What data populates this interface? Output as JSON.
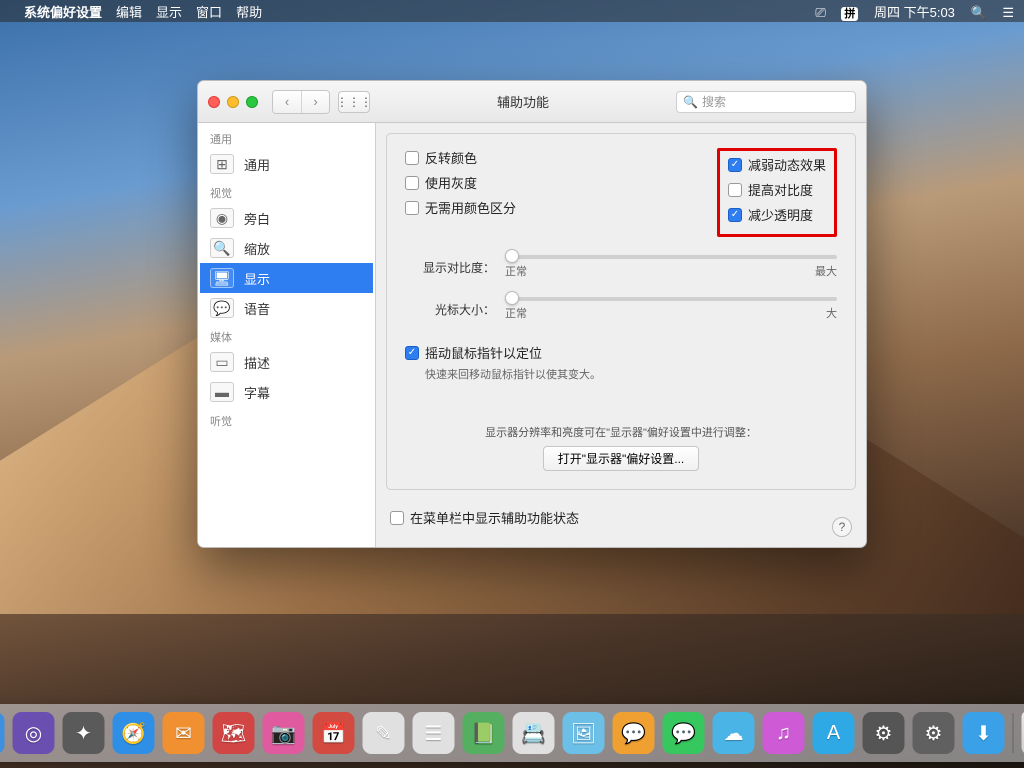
{
  "menubar": {
    "app": "系统偏好设置",
    "items": [
      "编辑",
      "显示",
      "窗口",
      "帮助"
    ],
    "pinyin": "拼",
    "datetime": "周四 下午5:03"
  },
  "window": {
    "title": "辅助功能",
    "search_placeholder": "搜索"
  },
  "sidebar": {
    "sections": [
      {
        "label": "通用",
        "items": [
          {
            "label": "通用",
            "icon": "⊞"
          }
        ]
      },
      {
        "label": "视觉",
        "items": [
          {
            "label": "旁白",
            "icon": "◉"
          },
          {
            "label": "缩放",
            "icon": "🔍"
          },
          {
            "label": "显示",
            "icon": "🖥",
            "selected": true
          },
          {
            "label": "语音",
            "icon": "💬"
          }
        ]
      },
      {
        "label": "媒体",
        "items": [
          {
            "label": "描述",
            "icon": "▭"
          },
          {
            "label": "字幕",
            "icon": "▬"
          }
        ]
      },
      {
        "label": "听觉",
        "items": []
      }
    ]
  },
  "options": {
    "left": [
      {
        "label": "反转颜色",
        "checked": false
      },
      {
        "label": "使用灰度",
        "checked": false
      },
      {
        "label": "无需用颜色区分",
        "checked": false
      }
    ],
    "right": [
      {
        "label": "减弱动态效果",
        "checked": true
      },
      {
        "label": "提高对比度",
        "checked": false
      },
      {
        "label": "减少透明度",
        "checked": true
      }
    ],
    "contrast": {
      "label": "显示对比度：",
      "min": "正常",
      "max": "最大"
    },
    "cursor": {
      "label": "光标大小：",
      "min": "正常",
      "max": "大"
    },
    "shake": {
      "label": "摇动鼠标指针以定位",
      "checked": true,
      "help": "快速来回移动鼠标指针以使其变大。"
    },
    "hint": "显示器分辨率和亮度可在\"显示器\"偏好设置中进行调整：",
    "open_btn": "打开\"显示器\"偏好设置..."
  },
  "footer": {
    "status_label": "在菜单栏中显示辅助功能状态",
    "checked": false
  },
  "dock_colors": [
    "#3d8fe0",
    "#6b4fb0",
    "#5a5a5a",
    "#2f8fe6",
    "#f09030",
    "#d14545",
    "#e05a9f",
    "#d24a40",
    "#e0e0e0",
    "#e0e0e0",
    "#54b060",
    "#e0e0e0",
    "#6cc0e8",
    "#f0a030",
    "#36c75e",
    "#4bb4e6",
    "#ce5ad6",
    "#2fa8e6",
    "#555555",
    "#606060",
    "#3aa0e8"
  ]
}
